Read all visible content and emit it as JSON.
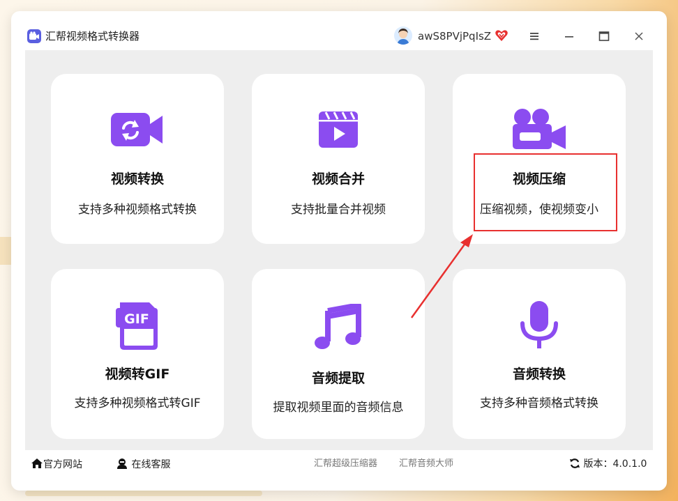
{
  "app": {
    "title": "汇帮视频格式转换器"
  },
  "user": {
    "name": "awS8PVjPqIsZ"
  },
  "cards": [
    {
      "title": "视频转换",
      "desc": "支持多种视频格式转换",
      "icon": "video-convert-icon"
    },
    {
      "title": "视频合并",
      "desc": "支持批量合并视频",
      "icon": "clapperboard-icon"
    },
    {
      "title": "视频压缩",
      "desc": "压缩视频，使视频变小",
      "icon": "video-camera-icon"
    },
    {
      "title": "视频转GIF",
      "desc": "支持多种视频格式转GIF",
      "icon": "gif-file-icon",
      "gif_label": "GIF"
    },
    {
      "title": "音频提取",
      "desc": "提取视频里面的音频信息",
      "icon": "music-note-icon"
    },
    {
      "title": "音频转换",
      "desc": "支持多种音频格式转换",
      "icon": "microphone-icon"
    }
  ],
  "footer": {
    "website": "官方网站",
    "support": "在线客服",
    "link1": "汇帮超级压缩器",
    "link2": "汇帮音频大师",
    "version_label": "版本：",
    "version": "4.0.1.0"
  },
  "colors": {
    "accent": "#8b4cf0",
    "highlight": "#e8302f",
    "window_bg": "#eeeeee"
  }
}
